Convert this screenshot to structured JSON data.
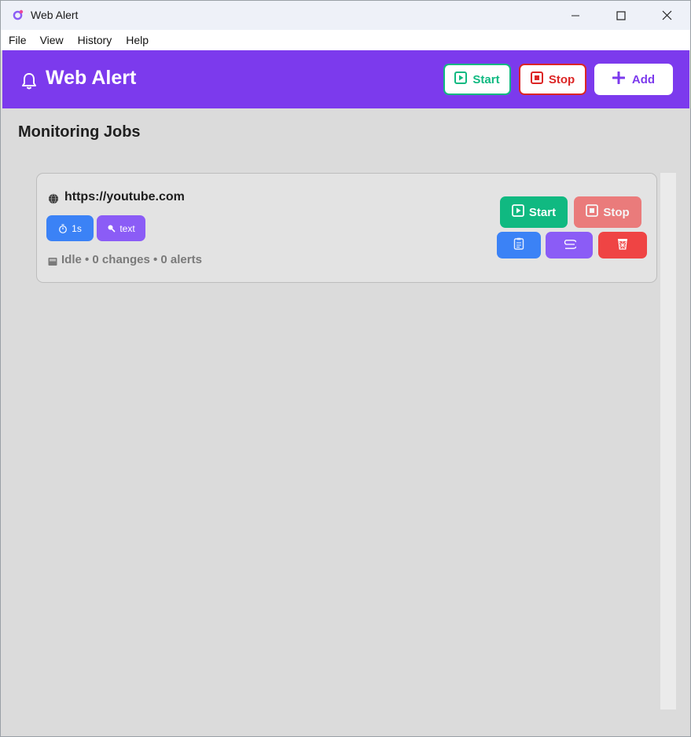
{
  "window": {
    "title": "Web Alert",
    "controls": [
      "minimize-icon",
      "maximize-icon",
      "close-icon"
    ]
  },
  "menu": {
    "items": [
      "File",
      "View",
      "History",
      "Help"
    ]
  },
  "header": {
    "title": "Web Alert",
    "icon": "bell-icon",
    "start_label": "Start",
    "stop_label": "Stop",
    "add_label": "Add",
    "colors": {
      "background": "#7c3aed",
      "start": "#10b981",
      "stop": "#dc2626",
      "add": "#7c3aed"
    }
  },
  "main": {
    "title": "Monitoring Jobs",
    "jobs": [
      {
        "url": "https://youtube.com",
        "icon": "globe-icon",
        "tags": [
          {
            "icon": "stopwatch-icon",
            "label": "1s",
            "color": "#3b82f6"
          },
          {
            "icon": "magnifier-icon",
            "label": "text",
            "color": "#8b5cf6"
          }
        ],
        "status": "Idle • 0 changes • 0 alerts",
        "status_icon": "inbox-icon",
        "actions": {
          "start_label": "Start",
          "stop_label": "Stop",
          "history_icon": "clipboard-icon",
          "edit_icon": "paperclip-icon",
          "delete_icon": "wastebasket-icon",
          "colors": {
            "start": "#10b981",
            "stop": "#ef4444",
            "history": "#3b82f6",
            "edit": "#8b5cf6",
            "delete": "#ef4444"
          }
        }
      }
    ]
  }
}
